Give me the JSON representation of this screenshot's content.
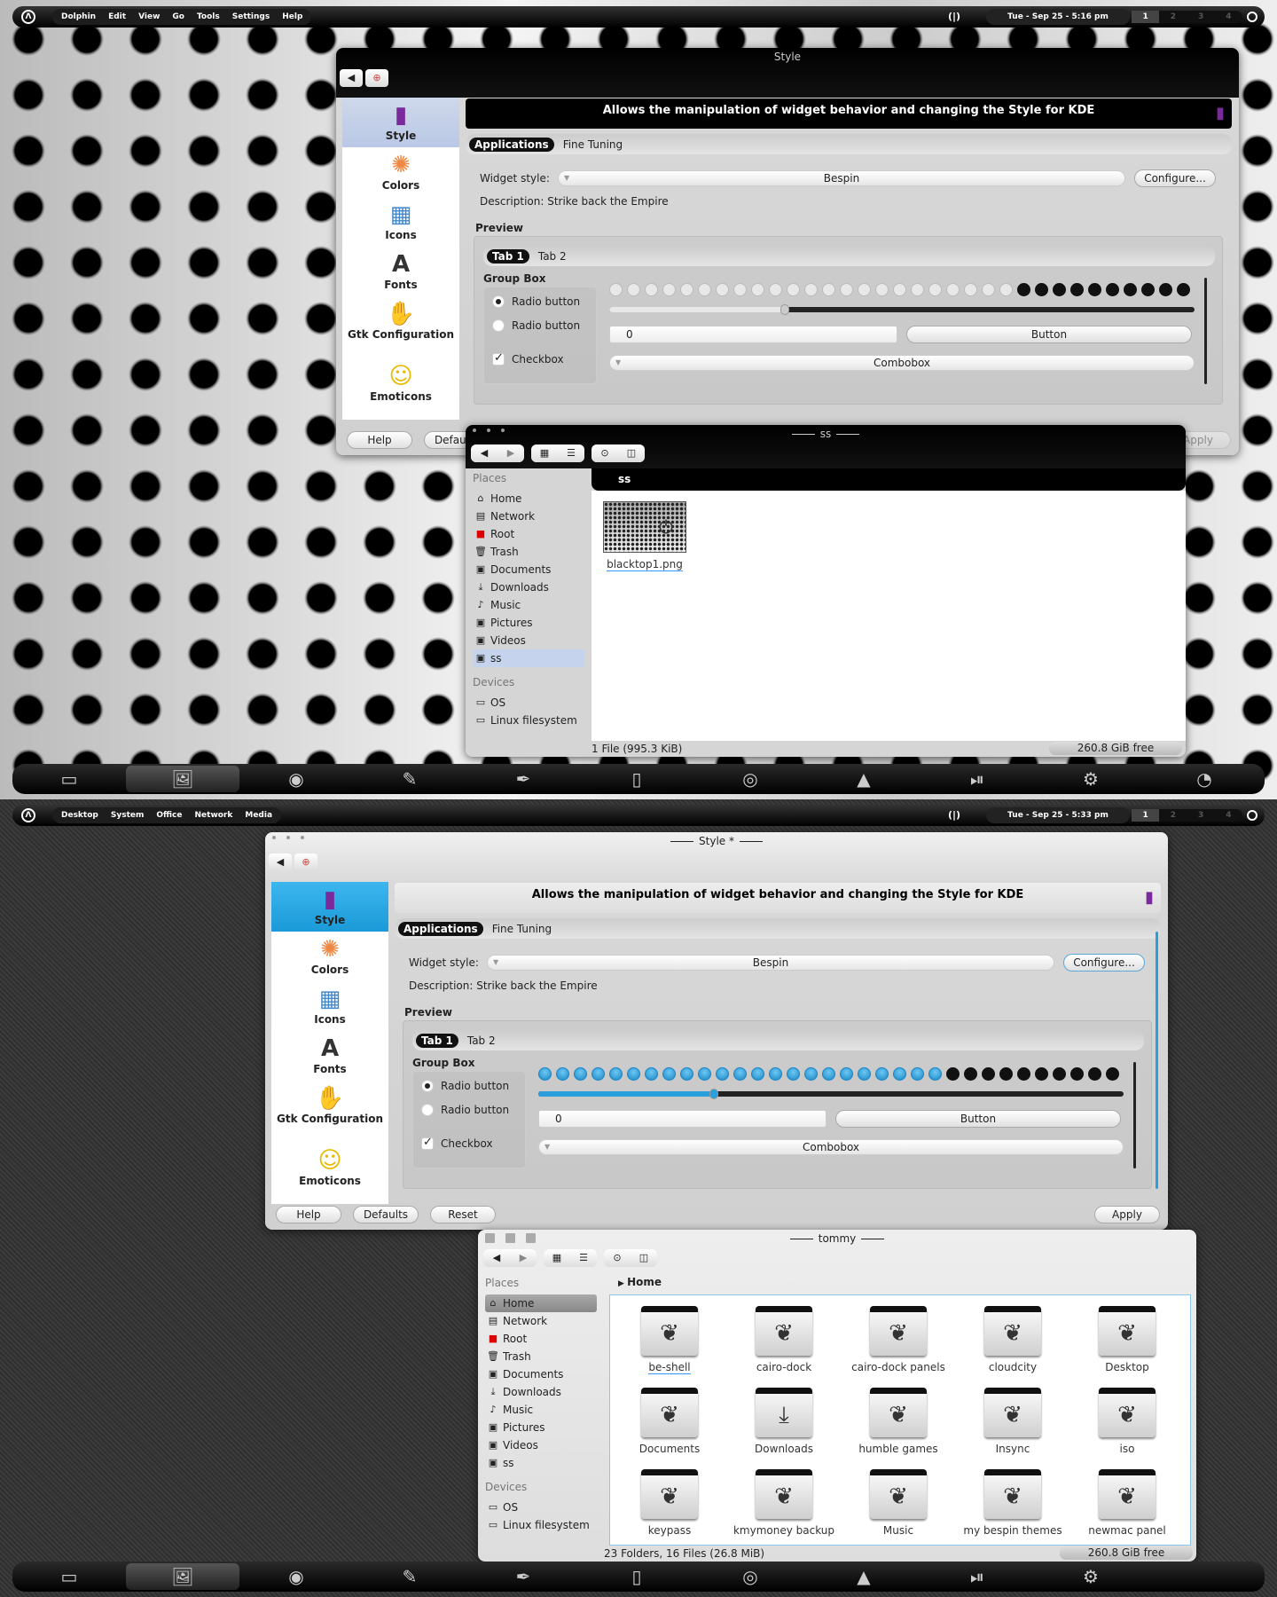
{
  "screens": [
    {
      "menubar": {
        "menus": [
          "Dolphin",
          "Edit",
          "View",
          "Go",
          "Tools",
          "Settings",
          "Help"
        ],
        "tray": "(|)",
        "clock": "Tue - Sep 25 - 5:16 pm",
        "workspaces": [
          "1",
          "2",
          "3",
          "4"
        ],
        "active_workspace": 0
      },
      "style_window": {
        "theme": "dark",
        "title": "Style",
        "sidebar": [
          {
            "label": "Style",
            "icon": "style-icon"
          },
          {
            "label": "Colors",
            "icon": "colors-icon"
          },
          {
            "label": "Icons",
            "icon": "icons-icon"
          },
          {
            "label": "Fonts",
            "icon": "fonts-icon"
          },
          {
            "label": "Gtk Configuration",
            "icon": "gtk-icon"
          },
          {
            "label": "Emoticons",
            "icon": "emoticons-icon"
          }
        ],
        "banner": "Allows the manipulation of widget behavior and changing the Style for KDE",
        "tabs": [
          "Applications",
          "Fine Tuning"
        ],
        "widget_style_label": "Widget style:",
        "widget_style_value": "Bespin",
        "configure": "Configure...",
        "description": "Description: Strike back the Empire",
        "preview_label": "Preview",
        "preview_tabs": [
          "Tab 1",
          "Tab 2"
        ],
        "group_box": "Group Box",
        "radio1": "Radio button",
        "radio2": "Radio button",
        "checkbox": "Checkbox",
        "spin_value": "0",
        "button": "Button",
        "combobox": "Combobox",
        "progress_percent": 70,
        "slider_percent": 30,
        "buttons": [
          "Help",
          "Defaults",
          "Apply"
        ]
      },
      "dolphin": {
        "theme": "dark",
        "title": "ss",
        "places_header": "Places",
        "places": [
          "Home",
          "Network",
          "Root",
          "Trash",
          "Documents",
          "Downloads",
          "Music",
          "Pictures",
          "Videos",
          "ss"
        ],
        "selected_place": 9,
        "devices_header": "Devices",
        "devices": [
          "OS",
          "Linux filesystem"
        ],
        "breadcrumb": "ss",
        "items": [
          {
            "name": "blacktop1.png",
            "type": "image"
          }
        ],
        "status": "1 File (995.3 KiB)",
        "free_space": "260.8 GiB free"
      },
      "taskbar": {
        "icons": [
          "terminal-icon",
          "image-viewer-icon",
          "chromium-icon",
          "text-editor-icon",
          "pen-icon",
          "tv-icon",
          "cd-icon",
          "vlc-icon",
          "media-player-icon",
          "settings-icon",
          "eye-icon"
        ],
        "active": 1
      }
    },
    {
      "menubar": {
        "menus": [
          "Desktop",
          "System",
          "Office",
          "Network",
          "Media"
        ],
        "tray": "(|)",
        "clock": "Tue - Sep 25 - 5:33 pm",
        "workspaces": [
          "1",
          "2",
          "3",
          "4"
        ],
        "active_workspace": 0
      },
      "style_window": {
        "theme": "light",
        "title": "Style *",
        "sidebar": [
          {
            "label": "Style",
            "icon": "style-icon"
          },
          {
            "label": "Colors",
            "icon": "colors-icon"
          },
          {
            "label": "Icons",
            "icon": "icons-icon"
          },
          {
            "label": "Fonts",
            "icon": "fonts-icon"
          },
          {
            "label": "Gtk Configuration",
            "icon": "gtk-icon"
          },
          {
            "label": "Emoticons",
            "icon": "emoticons-icon"
          }
        ],
        "banner": "Allows the manipulation of widget behavior and changing the Style for KDE",
        "tabs": [
          "Applications",
          "Fine Tuning"
        ],
        "widget_style_label": "Widget style:",
        "widget_style_value": "Bespin",
        "configure": "Configure...",
        "description": "Description: Strike back the Empire",
        "preview_label": "Preview",
        "preview_tabs": [
          "Tab 1",
          "Tab 2"
        ],
        "group_box": "Group Box",
        "radio1": "Radio button",
        "radio2": "Radio button",
        "checkbox": "Checkbox",
        "spin_value": "0",
        "button": "Button",
        "combobox": "Combobox",
        "progress_percent": 70,
        "slider_percent": 30,
        "buttons": [
          "Help",
          "Defaults",
          "Reset",
          "Apply"
        ]
      },
      "dolphin": {
        "theme": "light",
        "title": "tommy",
        "places_header": "Places",
        "places": [
          "Home",
          "Network",
          "Root",
          "Trash",
          "Documents",
          "Downloads",
          "Music",
          "Pictures",
          "Videos",
          "ss"
        ],
        "selected_place": 0,
        "devices_header": "Devices",
        "devices": [
          "OS",
          "Linux filesystem"
        ],
        "breadcrumb": "Home",
        "items": [
          {
            "name": "be-shell",
            "type": "folder"
          },
          {
            "name": "cairo-dock",
            "type": "folder"
          },
          {
            "name": "cairo-dock panels",
            "type": "folder"
          },
          {
            "name": "cloudcity",
            "type": "folder"
          },
          {
            "name": "Desktop",
            "type": "folder"
          },
          {
            "name": "Documents",
            "type": "folder"
          },
          {
            "name": "Downloads",
            "type": "downloads"
          },
          {
            "name": "humble games",
            "type": "folder"
          },
          {
            "name": "Insync",
            "type": "folder"
          },
          {
            "name": "iso",
            "type": "folder"
          },
          {
            "name": "keypass",
            "type": "folder"
          },
          {
            "name": "kmymoney backup",
            "type": "folder"
          },
          {
            "name": "Music",
            "type": "folder"
          },
          {
            "name": "my bespin themes",
            "type": "folder"
          },
          {
            "name": "newmac panel",
            "type": "folder"
          }
        ],
        "status": "23 Folders, 16 Files (26.8 MiB)",
        "free_space": "260.8 GiB free"
      },
      "taskbar": {
        "icons": [
          "terminal-icon",
          "image-viewer-icon",
          "chromium-icon",
          "text-editor-icon",
          "pen-icon",
          "tv-icon",
          "cd-icon",
          "vlc-icon",
          "media-player-icon",
          "settings-icon"
        ],
        "active": 1
      }
    }
  ]
}
